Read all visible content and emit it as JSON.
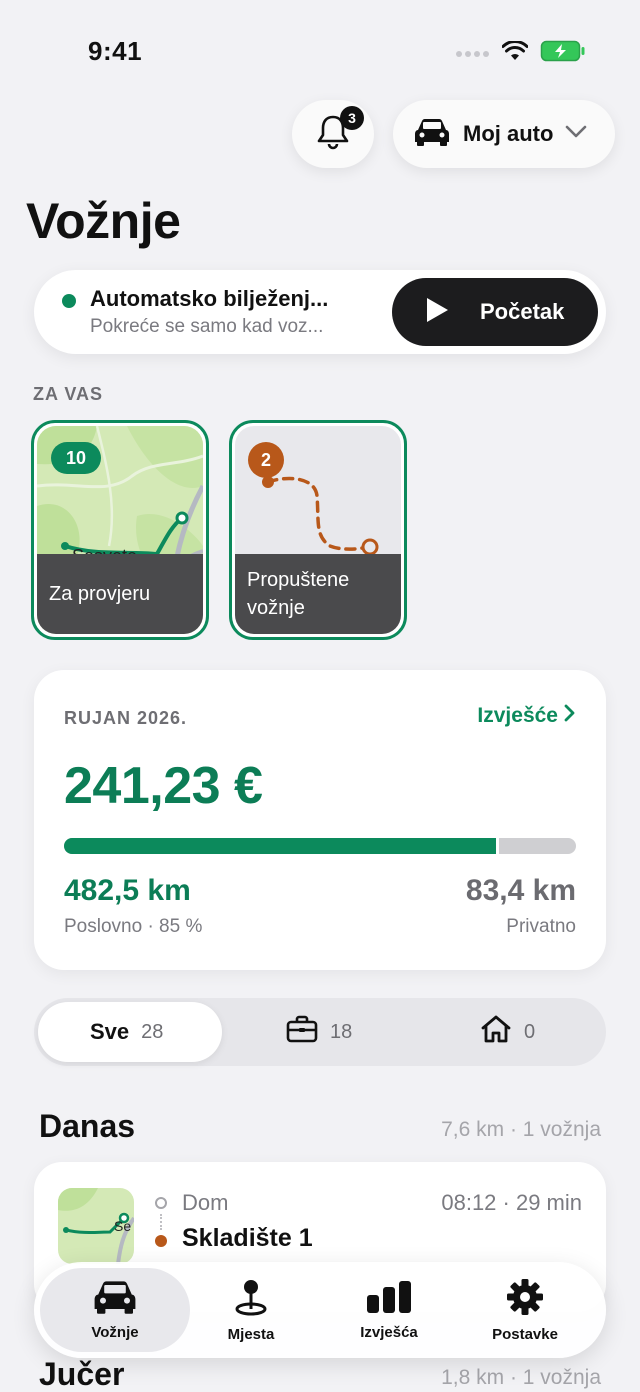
{
  "status_bar": {
    "time": "9:41"
  },
  "header": {
    "notifications_count": "3",
    "vehicle_label": "Moj auto"
  },
  "page_title": "Vožnje",
  "auto_record": {
    "title": "Automatsko bilježenj...",
    "subtitle": "Pokreće se samo kad voz...",
    "start_label": "Početak"
  },
  "for_you": {
    "section_label": "ZA VAS",
    "tiles": [
      {
        "badge": "10",
        "map_label": "Sesvete",
        "label": "Za provjeru"
      },
      {
        "badge": "2",
        "label_line1": "Propuštene",
        "label_line2": "vožnje"
      }
    ]
  },
  "month_summary": {
    "month_label": "RUJAN 2026.",
    "report_link": "Izvješće",
    "amount": "241,23 €",
    "business_share": 0.85,
    "business_km": "482,5 km",
    "business_sub": "Poslovno · 85 %",
    "private_km": "83,4 km",
    "private_sub": "Privatno"
  },
  "filter": {
    "all_label": "Sve",
    "all_count": "28",
    "business_count": "18",
    "private_count": "0"
  },
  "days": [
    {
      "title": "Danas",
      "meta": "7,6 km · 1 vožnja",
      "trip": {
        "from": "Dom",
        "to": "Skladište 1",
        "time": "08:12 · 29 min",
        "thumb_label": "Se"
      }
    },
    {
      "title": "Jučer",
      "meta": "1,8 km · 1 vožnja"
    }
  ],
  "tab_bar": {
    "tabs": [
      {
        "label": "Vožnje",
        "icon": "car-icon"
      },
      {
        "label": "Mjesta",
        "icon": "map-pin-icon"
      },
      {
        "label": "Izvješća",
        "icon": "bar-chart-icon"
      },
      {
        "label": "Postavke",
        "icon": "gear-icon"
      }
    ]
  },
  "colors": {
    "accent": "#0c8a5c",
    "accent_dark": "#0c7d56",
    "orange": "#b8581a",
    "dark": "#1c1c1e"
  }
}
